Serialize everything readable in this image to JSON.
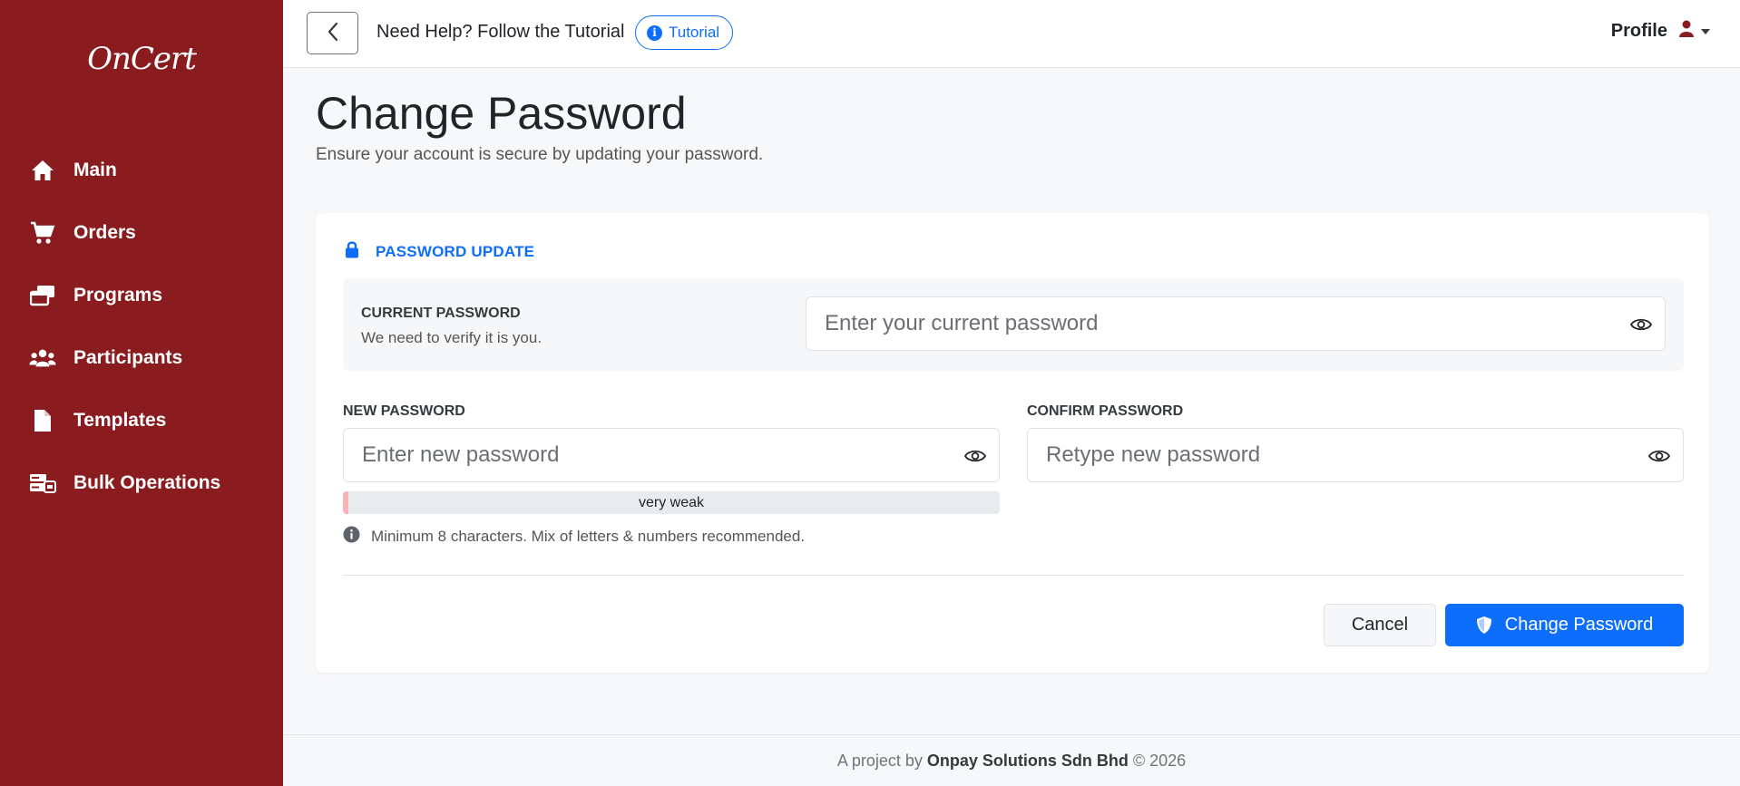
{
  "brand": {
    "logo_text": "OnCert"
  },
  "sidebar": {
    "items": [
      {
        "label": "Main",
        "icon": "home-icon"
      },
      {
        "label": "Orders",
        "icon": "cart-icon"
      },
      {
        "label": "Programs",
        "icon": "programs-icon"
      },
      {
        "label": "Participants",
        "icon": "users-icon"
      },
      {
        "label": "Templates",
        "icon": "file-icon"
      },
      {
        "label": "Bulk Operations",
        "icon": "bulk-operations-icon"
      }
    ]
  },
  "header": {
    "help_text": "Need Help? Follow the Tutorial",
    "tutorial_label": "Tutorial",
    "profile_label": "Profile"
  },
  "page": {
    "title": "Change Password",
    "subtitle": "Ensure your account is secure by updating your password."
  },
  "form": {
    "section_title": "PASSWORD UPDATE",
    "current": {
      "label": "CURRENT PASSWORD",
      "hint": "We need to verify it is you.",
      "placeholder": "Enter your current password"
    },
    "new_password": {
      "label": "NEW PASSWORD",
      "placeholder": "Enter new password"
    },
    "confirm_password": {
      "label": "CONFIRM PASSWORD",
      "placeholder": "Retype new password"
    },
    "strength": {
      "label": "very weak",
      "fraction": 0.008
    },
    "requirement_hint": "Minimum 8 characters. Mix of letters & numbers recommended.",
    "cancel_label": "Cancel",
    "submit_label": "Change Password"
  },
  "footer": {
    "prefix": "A project by",
    "company": "Onpay Solutions Sdn Bhd",
    "suffix": "© 2026"
  },
  "colors": {
    "sidebar_bg": "#8a1c1f",
    "primary": "#0d6efd",
    "strength_fill": "#f8b3b8"
  }
}
